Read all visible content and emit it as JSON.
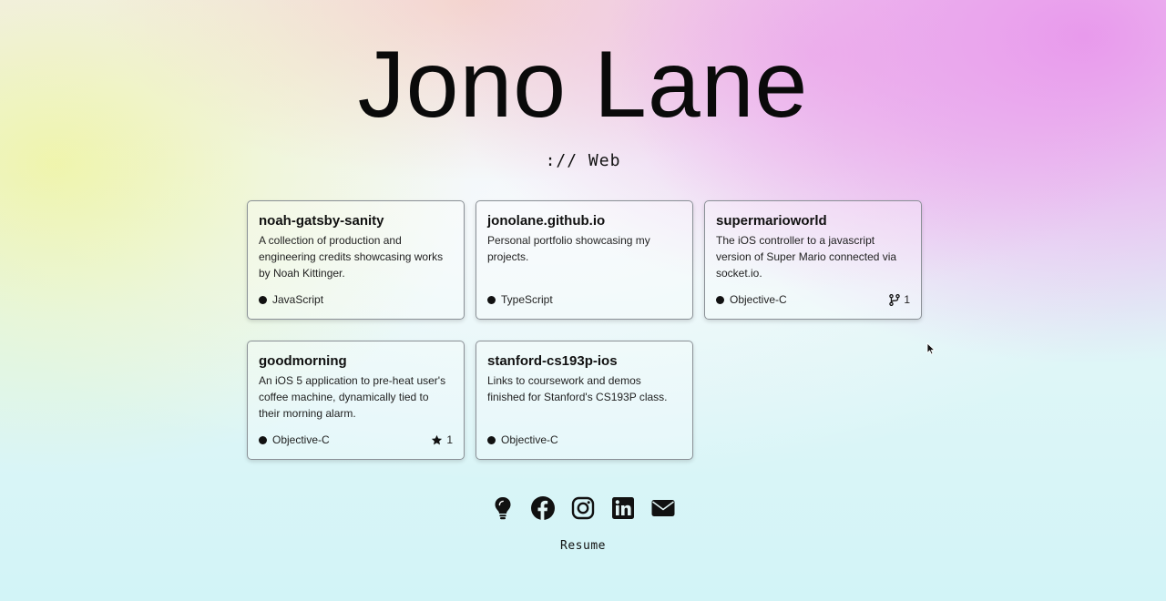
{
  "header": {
    "title": "Jono Lane",
    "subtitle": ":// Web"
  },
  "repos": [
    {
      "name": "noah-gatsby-sanity",
      "description": "A collection of production and engineering credits showcasing works by Noah Kittinger.",
      "language": "JavaScript",
      "stat_icon": null,
      "stat_count": ""
    },
    {
      "name": "jonolane.github.io",
      "description": "Personal portfolio showcasing my projects.",
      "language": "TypeScript",
      "stat_icon": null,
      "stat_count": ""
    },
    {
      "name": "supermarioworld",
      "description": "The iOS controller to a javascript version of Super Mario connected via socket.io.",
      "language": "Objective-C",
      "stat_icon": "fork-icon",
      "stat_count": "1"
    },
    {
      "name": "goodmorning",
      "description": "An iOS 5 application to pre-heat user's coffee machine, dynamically tied to their morning alarm.",
      "language": "Objective-C",
      "stat_icon": "star-icon",
      "stat_count": "1"
    },
    {
      "name": "stanford-cs193p-ios",
      "description": "Links to coursework and demos finished for Stanford's CS193P class.",
      "language": "Objective-C",
      "stat_icon": null,
      "stat_count": ""
    }
  ],
  "social": {
    "icons": [
      "lightbulb-icon",
      "facebook-icon",
      "instagram-icon",
      "linkedin-icon",
      "mail-icon"
    ]
  },
  "footer": {
    "resume_label": "Resume"
  },
  "colors": {
    "text": "#111111",
    "card_border": "#8a9096",
    "gradient_pink": "#e896ec",
    "gradient_yellow": "#f0f5a0",
    "gradient_cyan": "#d2f4f7"
  }
}
